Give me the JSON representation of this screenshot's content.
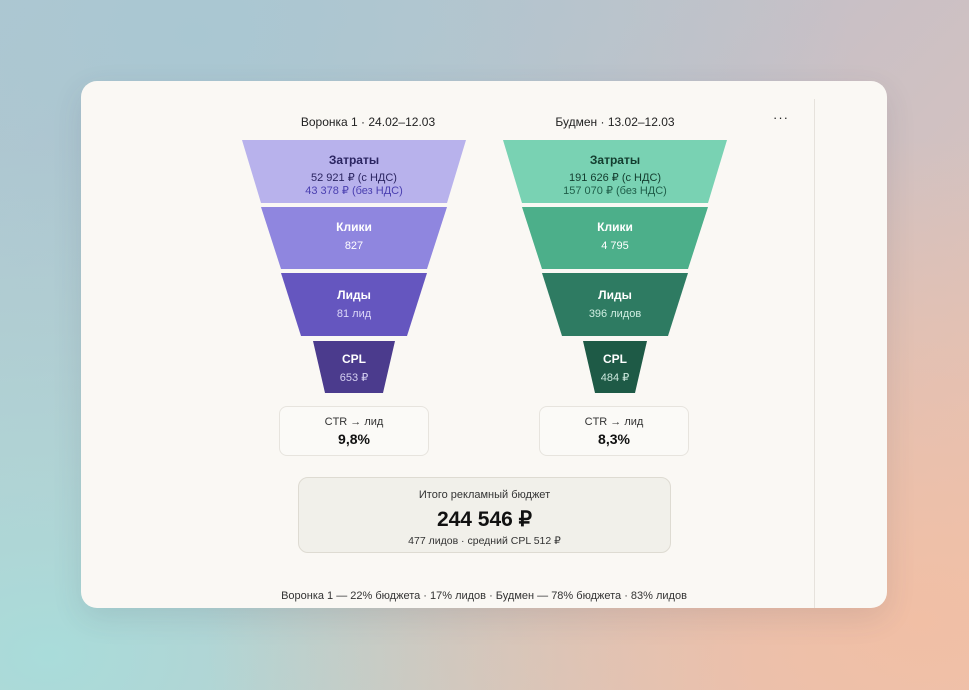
{
  "menu_label": "···",
  "funnels": [
    {
      "title": "Воронка 1 · 24.02–12.03",
      "stages": [
        {
          "label": "Затраты",
          "line1": "52 921 ₽ (с НДС)",
          "line2": "43 378 ₽ (без НДС)",
          "color": "#b8b2ec"
        },
        {
          "label": "Клики",
          "line1": "827",
          "color": "#8f86df"
        },
        {
          "label": "Лиды",
          "line1": "81 лид",
          "color": "#6556bf"
        },
        {
          "label": "CPL",
          "line1": "653 ₽",
          "color": "#4b3b8d"
        }
      ],
      "metric": {
        "label": "CTR → лид",
        "value": "9,8%"
      }
    },
    {
      "title": "Будмен · 13.02–12.03",
      "stages": [
        {
          "label": "Затраты",
          "line1": "191 626 ₽ (с НДС)",
          "line2": "157 070 ₽ (без НДС)",
          "color": "#79d2b3"
        },
        {
          "label": "Клики",
          "line1": "4 795",
          "color": "#4caf8a"
        },
        {
          "label": "Лиды",
          "line1": "396 лидов",
          "color": "#2e7b62"
        },
        {
          "label": "CPL",
          "line1": "484 ₽",
          "color": "#1e5a46"
        }
      ],
      "metric": {
        "label": "CTR → лид",
        "value": "8,3%"
      }
    }
  ],
  "total": {
    "label": "Итого рекламный бюджет",
    "value": "244 546 ₽",
    "sub": "477 лидов · средний CPL 512 ₽"
  },
  "footer": "Воронка 1 — 22% бюджета · 17% лидов · Будмен — 78% бюджета · 83% лидов"
}
